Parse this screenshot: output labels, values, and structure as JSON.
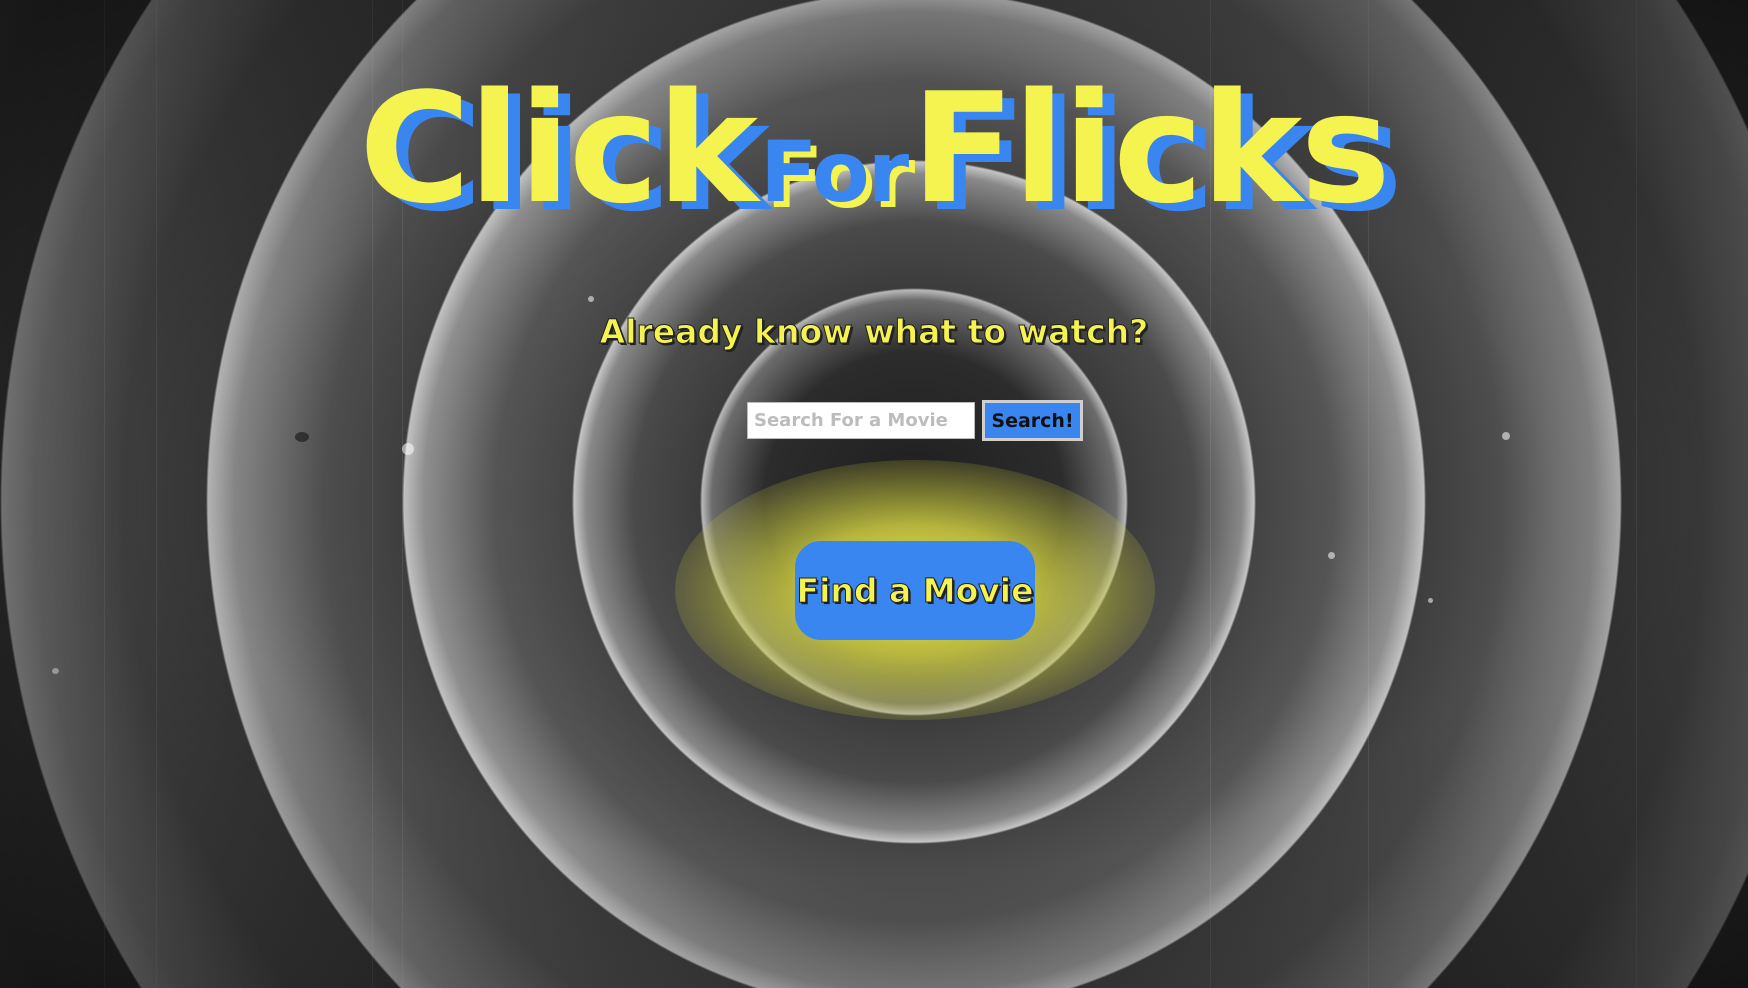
{
  "logo": {
    "part1": "Click",
    "part2": "For",
    "part3": "Flicks"
  },
  "tagline": "Already know what to watch?",
  "search": {
    "placeholder": "Search For a Movie",
    "value": "",
    "button_label": "Search!"
  },
  "find_button": {
    "label": "Find a Movie"
  },
  "colors": {
    "accent_yellow": "#f4f350",
    "accent_blue": "#3a86f0"
  }
}
